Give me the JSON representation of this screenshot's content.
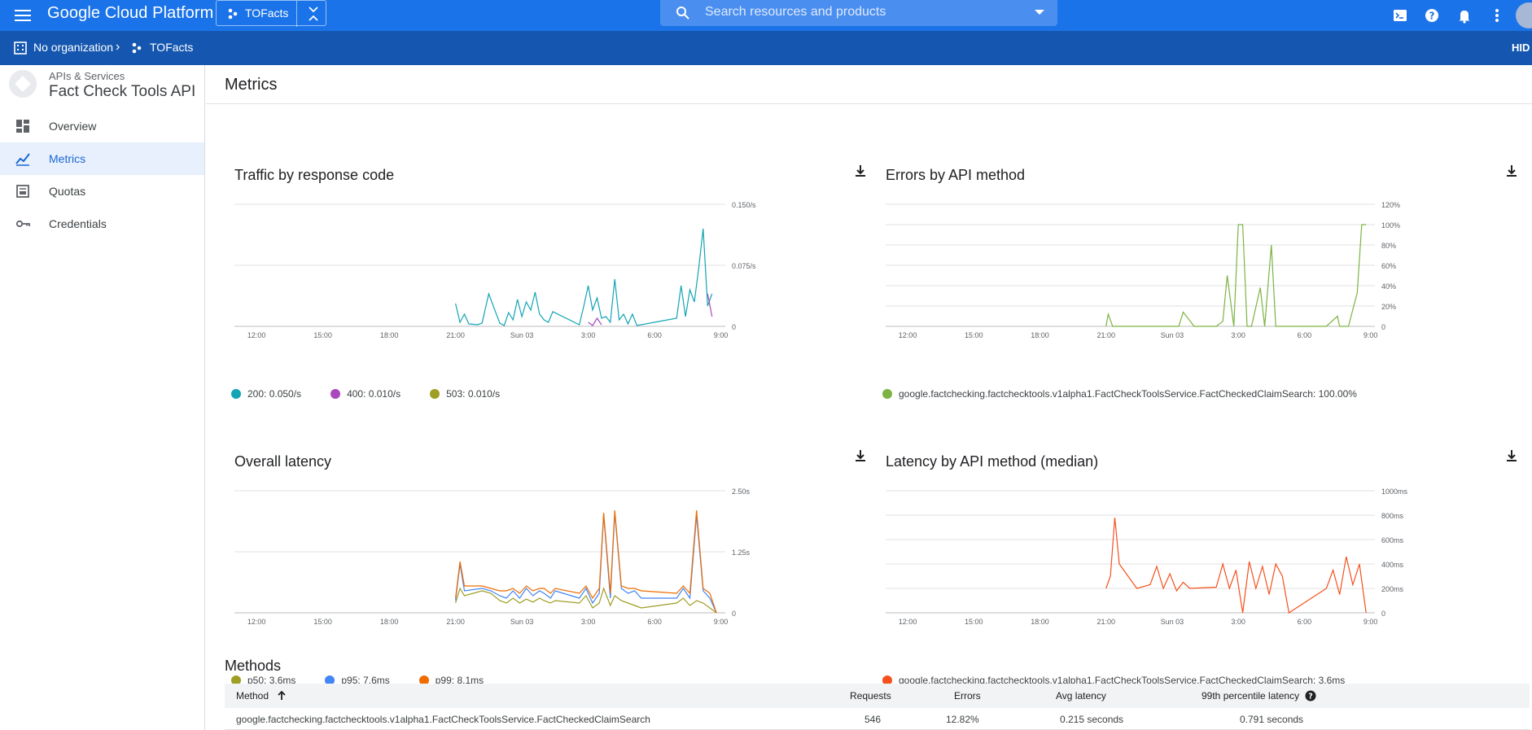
{
  "topbar": {
    "brand": "Google Cloud Platform",
    "project": "TOFacts",
    "search_placeholder": "Search resources and products"
  },
  "orgbar": {
    "org": "No organization",
    "project": "TOFacts",
    "hide": "HID"
  },
  "sidebar": {
    "subtitle": "APIs & Services",
    "title": "Fact Check Tools API",
    "items": [
      {
        "label": "Overview",
        "icon": "dashboard-icon",
        "active": false
      },
      {
        "label": "Metrics",
        "icon": "chart-icon",
        "active": true
      },
      {
        "label": "Quotas",
        "icon": "quota-icon",
        "active": false
      },
      {
        "label": "Credentials",
        "icon": "key-icon",
        "active": false
      }
    ]
  },
  "main": {
    "title": "Metrics",
    "methods_title": "Methods"
  },
  "chart_data": [
    {
      "type": "line",
      "title": "Traffic by response code",
      "x_ticks": [
        "12:00",
        "15:00",
        "18:00",
        "21:00",
        "Sun 03",
        "3:00",
        "6:00",
        "9:00"
      ],
      "y_ticks": [
        "0",
        "0.075/s",
        "0.150/s"
      ],
      "ylim": [
        0,
        0.15
      ],
      "x": [
        21.0,
        21.2,
        21.4,
        21.6,
        22.0,
        22.2,
        22.5,
        23.0,
        23.2,
        23.4,
        23.6,
        23.8,
        24.0,
        24.2,
        24.4,
        24.6,
        24.8,
        25.0,
        25.2,
        25.4,
        26.6,
        26.8,
        27.0,
        27.2,
        27.4,
        27.6,
        27.8,
        28.0,
        28.2,
        28.4,
        28.6,
        28.8,
        29.0,
        29.2,
        29.4,
        31.0,
        31.2,
        31.4,
        31.6,
        31.8,
        32.0,
        32.2,
        32.4,
        32.6
      ],
      "series": [
        {
          "name": "200",
          "color": "#12a4b4",
          "legend": "200: 0.050/s",
          "values": [
            0.028,
            0.005,
            0.015,
            0.003,
            0.002,
            0.004,
            0.04,
            0.004,
            0.001,
            0.017,
            0.008,
            0.033,
            0.012,
            0.03,
            0.02,
            0.042,
            0.015,
            0.008,
            0.005,
            0.018,
            0.002,
            0.025,
            0.05,
            0.02,
            0.035,
            0.01,
            0.012,
            0.005,
            0.058,
            0.008,
            0.015,
            0.003,
            0.015,
            0.001,
            0.002,
            0.01,
            0.05,
            0.012,
            0.045,
            0.03,
            0.072,
            0.12,
            0.025,
            0.04
          ]
        },
        {
          "name": "400",
          "color": "#ab47bc",
          "legend": "400: 0.010/s",
          "values": [
            null,
            null,
            null,
            null,
            null,
            null,
            null,
            null,
            null,
            null,
            null,
            null,
            null,
            null,
            null,
            null,
            null,
            null,
            null,
            null,
            null,
            null,
            0.005,
            0.001,
            0.01,
            0.002,
            null,
            null,
            null,
            null,
            null,
            null,
            null,
            null,
            null,
            null,
            null,
            null,
            null,
            null,
            null,
            null,
            0.04,
            0.012
          ]
        },
        {
          "name": "503",
          "color": "#9e9d24",
          "legend": "503: 0.010/s",
          "values": []
        }
      ]
    },
    {
      "type": "line",
      "title": "Errors by API method",
      "x_ticks": [
        "12:00",
        "15:00",
        "18:00",
        "21:00",
        "Sun 03",
        "3:00",
        "6:00",
        "9:00"
      ],
      "y_ticks": [
        "0",
        "20%",
        "40%",
        "60%",
        "80%",
        "100%",
        "120%"
      ],
      "ylim": [
        0,
        120
      ],
      "x": [
        21.0,
        21.1,
        21.3,
        22.0,
        22.3,
        23.0,
        23.4,
        24.0,
        24.3,
        24.5,
        25.0,
        25.6,
        26.0,
        26.3,
        26.5,
        26.8,
        27.0,
        27.2,
        27.4,
        27.6,
        28.0,
        28.2,
        28.5,
        28.7,
        29.0,
        29.3,
        31.0,
        31.5,
        31.6,
        32.0,
        32.4,
        32.6,
        32.8
      ],
      "series": [
        {
          "name": "google.factchecking.factchecktools.v1alpha1.FactCheckToolsService.FactCheckedClaimSearch",
          "color": "#7cb342",
          "legend": "google.factchecking.factchecktools.v1alpha1.FactCheckToolsService.FactCheckedClaimSearch: 100.00%",
          "values": [
            0,
            12,
            0,
            0,
            0,
            0,
            0,
            0,
            0,
            14,
            0,
            0,
            0,
            5,
            50,
            0,
            100,
            100,
            0,
            0,
            38,
            0,
            80,
            0,
            0,
            0,
            0,
            10,
            0,
            0,
            33,
            100,
            100
          ]
        }
      ]
    },
    {
      "type": "line",
      "title": "Overall latency",
      "x_ticks": [
        "12:00",
        "15:00",
        "18:00",
        "21:00",
        "Sun 03",
        "3:00",
        "6:00",
        "9:00"
      ],
      "y_ticks": [
        "0",
        "1.25s",
        "2.50s"
      ],
      "ylim": [
        0,
        2.5
      ],
      "x": [
        21.0,
        21.2,
        21.4,
        22.2,
        22.6,
        23.0,
        23.3,
        23.6,
        23.9,
        24.2,
        24.5,
        24.8,
        25.0,
        25.3,
        25.5,
        26.6,
        26.9,
        27.2,
        27.5,
        27.7,
        28.0,
        28.2,
        28.5,
        28.8,
        29.1,
        29.4,
        31.0,
        31.3,
        31.6,
        31.9,
        32.2,
        32.5,
        32.8
      ],
      "series": [
        {
          "name": "p50",
          "color": "#9e9d24",
          "legend": "p50: 3.6ms",
          "values": [
            0.2,
            0.5,
            0.35,
            0.45,
            0.4,
            0.25,
            0.2,
            0.3,
            0.2,
            0.28,
            0.22,
            0.3,
            0.25,
            0.2,
            0.25,
            0.2,
            0.35,
            0.1,
            0.2,
            0.5,
            0.15,
            0.35,
            0.25,
            0.2,
            0.15,
            0.1,
            0.2,
            0.3,
            0.15,
            0.25,
            0.2,
            0.1,
            0.0
          ]
        },
        {
          "name": "p95",
          "color": "#4285f4",
          "legend": "p95: 7.6ms",
          "values": [
            0.25,
            1.0,
            0.45,
            0.5,
            0.45,
            0.35,
            0.3,
            0.45,
            0.3,
            0.5,
            0.35,
            0.45,
            0.4,
            0.3,
            0.45,
            0.3,
            0.5,
            0.2,
            0.4,
            2.0,
            0.3,
            2.05,
            0.5,
            0.4,
            0.45,
            0.3,
            0.3,
            0.5,
            0.3,
            2.0,
            0.45,
            0.3,
            0.0
          ]
        },
        {
          "name": "p99",
          "color": "#ef6c00",
          "legend": "p99: 8.1ms",
          "values": [
            0.3,
            1.05,
            0.55,
            0.55,
            0.5,
            0.45,
            0.45,
            0.5,
            0.4,
            0.55,
            0.45,
            0.5,
            0.5,
            0.4,
            0.5,
            0.4,
            0.55,
            0.3,
            0.5,
            2.05,
            0.4,
            2.1,
            0.55,
            0.5,
            0.5,
            0.45,
            0.4,
            0.55,
            0.4,
            2.1,
            0.5,
            0.4,
            0.0
          ]
        }
      ]
    },
    {
      "type": "line",
      "title": "Latency by API method (median)",
      "x_ticks": [
        "12:00",
        "15:00",
        "18:00",
        "21:00",
        "Sun 03",
        "3:00",
        "6:00",
        "9:00"
      ],
      "y_ticks": [
        "0",
        "200ms",
        "400ms",
        "600ms",
        "800ms",
        "1000ms"
      ],
      "ylim": [
        0,
        1000
      ],
      "x": [
        21.0,
        21.2,
        21.4,
        21.6,
        22.4,
        23.0,
        23.3,
        23.6,
        23.9,
        24.2,
        24.5,
        24.8,
        26.0,
        26.3,
        26.6,
        26.9,
        27.2,
        27.5,
        27.8,
        28.1,
        28.4,
        28.7,
        29.0,
        29.3,
        31.0,
        31.3,
        31.6,
        31.9,
        32.2,
        32.5,
        32.8
      ],
      "series": [
        {
          "name": "google.factchecking.factchecktools.v1alpha1.FactCheckToolsService.FactCheckedClaimSearch",
          "color": "#f4511e",
          "legend": "google.factchecking.factchecktools.v1alpha1.FactCheckToolsService.FactCheckedClaimSearch: 3.6ms",
          "values": [
            200,
            300,
            780,
            400,
            200,
            230,
            380,
            200,
            320,
            180,
            250,
            200,
            210,
            400,
            200,
            350,
            0,
            420,
            200,
            380,
            150,
            400,
            300,
            0,
            200,
            350,
            150,
            460,
            230,
            400,
            0
          ]
        }
      ]
    }
  ],
  "methods_table": {
    "headers": {
      "method": "Method",
      "requests": "Requests",
      "errors": "Errors",
      "avg_latency": "Avg latency",
      "p99_latency": "99th percentile latency"
    },
    "rows": [
      {
        "method": "google.factchecking.factchecktools.v1alpha1.FactCheckToolsService.FactCheckedClaimSearch",
        "requests": "546",
        "errors": "12.82%",
        "avg_latency": "0.215 seconds",
        "p99_latency": "0.791 seconds"
      }
    ]
  }
}
